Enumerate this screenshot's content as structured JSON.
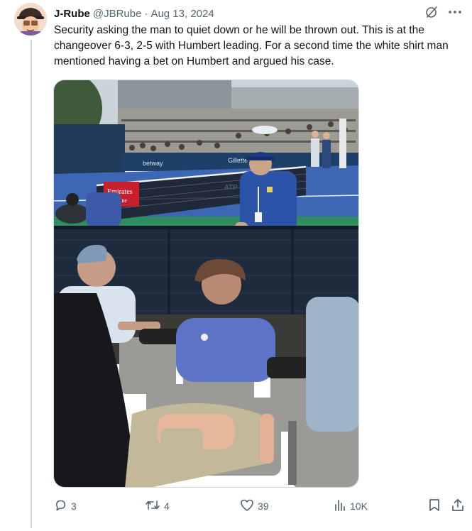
{
  "author": {
    "display_name": "J-Rube",
    "handle": "@JBRube",
    "separator": "·",
    "date": "Aug 13, 2024"
  },
  "header_icons": [
    "grok-icon",
    "more-icon"
  ],
  "tweet": {
    "text": "Security asking the man to quiet down or he will be thrown out. This is at the changeover 6-3, 2-5 with Humbert leading. For a second time the white shirt man mentioned having a bet on Humbert and argued his case."
  },
  "media": {
    "court_signs": {
      "left_board": "betway",
      "center_board": "Gillette",
      "emirates": "Emirates",
      "emirates_2": "irline",
      "net_logo": "ATP"
    }
  },
  "actions": {
    "replies": "3",
    "reposts": "4",
    "likes": "39",
    "views": "10K"
  },
  "icons": {
    "reply": "reply-icon",
    "repost": "repost-icon",
    "like": "heart-icon",
    "views": "views-icon",
    "bookmark": "bookmark-icon",
    "share": "share-icon"
  },
  "colors": {
    "text_primary": "#0f1419",
    "text_secondary": "#536471",
    "border": "#cfd9de",
    "court_blue": "#3d66b4",
    "court_green": "#2f8d5f"
  }
}
